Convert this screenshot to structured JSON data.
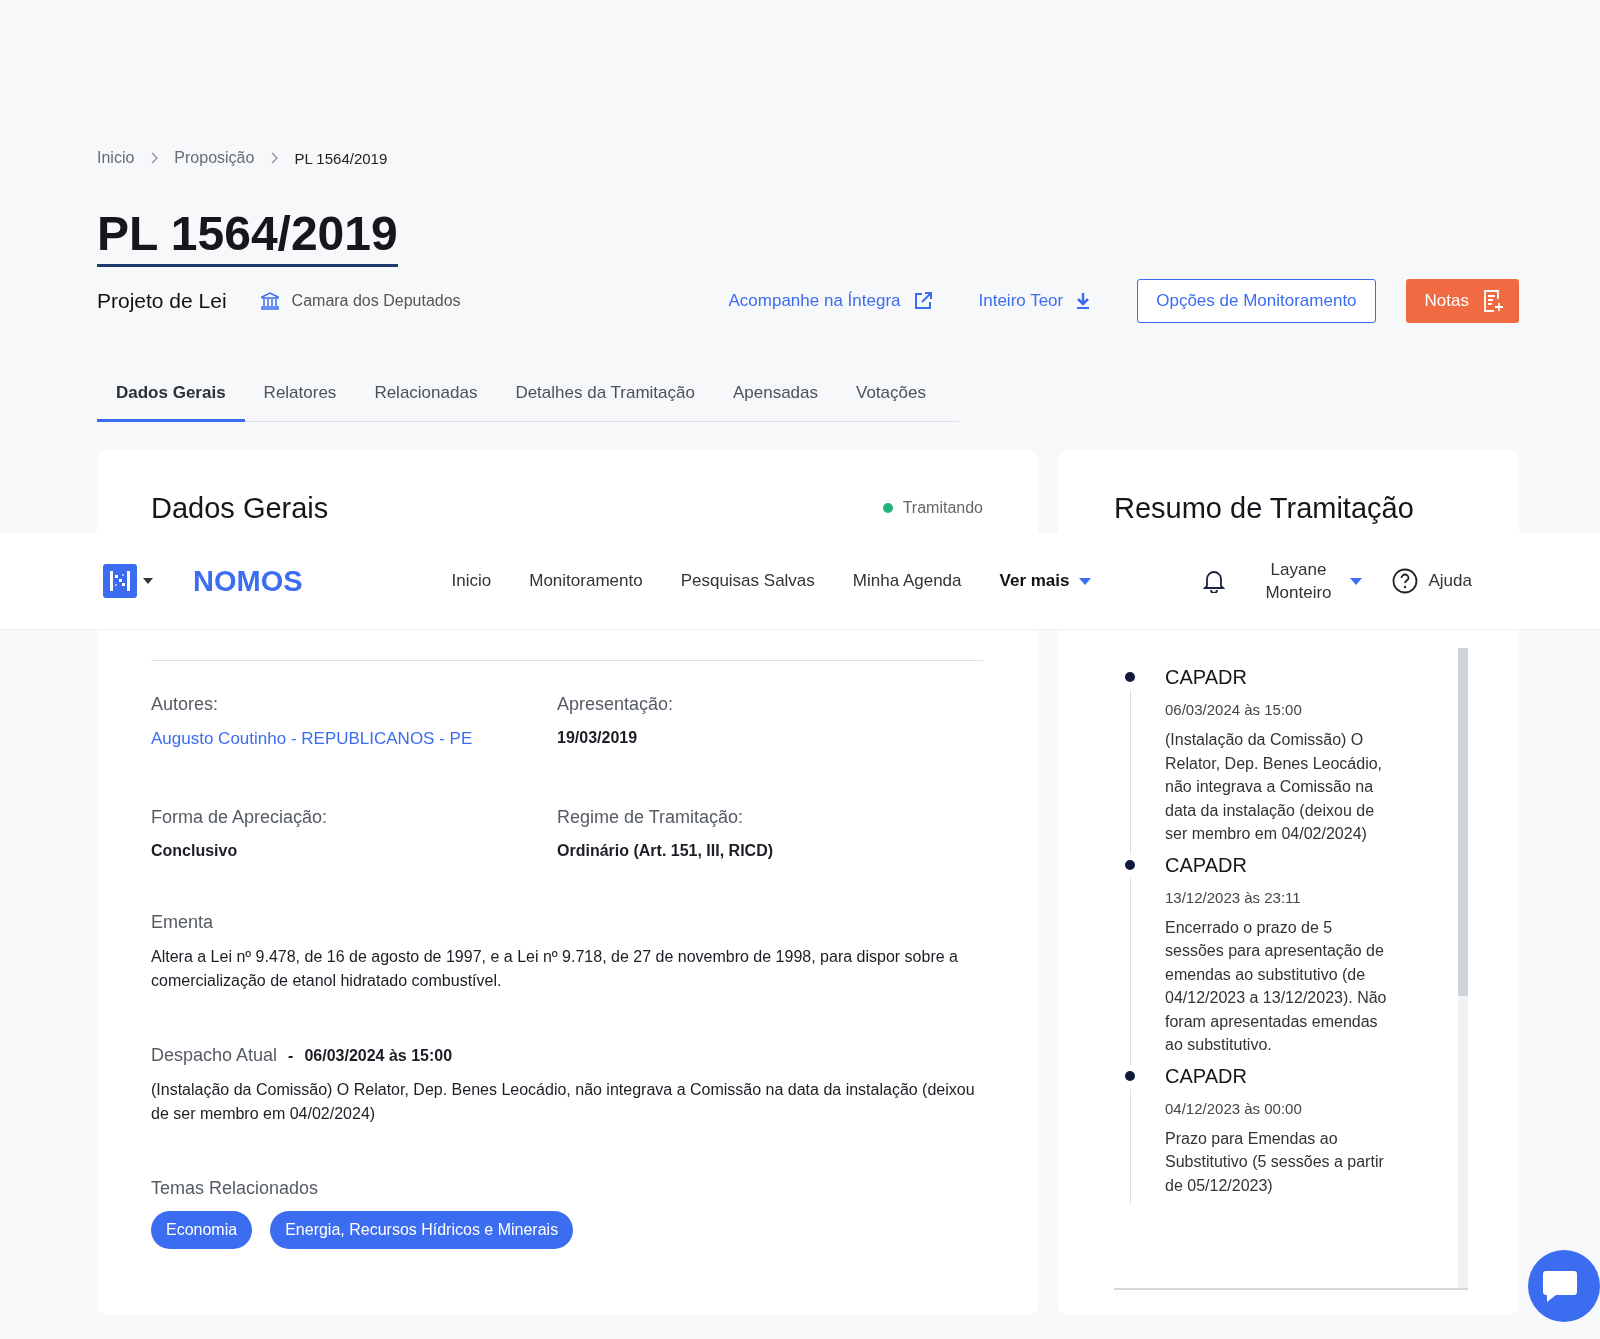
{
  "breadcrumb": [
    {
      "label": "Inicio"
    },
    {
      "label": "Proposição"
    },
    {
      "label": "PL 1564/2019"
    }
  ],
  "title": "PL 1564/2019",
  "subtitle": {
    "type": "Projeto de Lei",
    "house": "Camara dos Deputados"
  },
  "actions": [
    {
      "kind": "external",
      "label": "Acompanhe na Íntegra"
    },
    {
      "kind": "download",
      "label": "Inteiro Teor"
    },
    {
      "kind": "outline",
      "label": "Opções de Monitoramento"
    },
    {
      "kind": "notes",
      "label": "Notas"
    }
  ],
  "tabs": [
    {
      "label": "Dados Gerais",
      "selected": true
    },
    {
      "label": "Relatores",
      "selected": false
    },
    {
      "label": "Relacionadas",
      "selected": false
    },
    {
      "label": "Detalhes da Tramitação",
      "selected": false
    },
    {
      "label": "Apensadas",
      "selected": false
    },
    {
      "label": "Votações",
      "selected": false
    }
  ],
  "general": {
    "title": "Dados Gerais",
    "status": {
      "label": "Tramitando",
      "color": "#1fb57a"
    },
    "fields": [
      {
        "label": "Autores:",
        "value": "Augusto Coutinho - REPUBLICANOS - PE",
        "kind": "link"
      },
      {
        "label": "Apresentação:",
        "value": "19/03/2019",
        "kind": "text"
      },
      {
        "label": "Forma de Apreciação:",
        "value": "Conclusivo",
        "kind": "text"
      },
      {
        "label": "Regime de Tramitação:",
        "value": "Ordinário (Art. 151, III, RICD)",
        "kind": "text"
      }
    ],
    "ementa": {
      "label": "Ementa",
      "text": "Altera a Lei nº 9.478, de 16 de agosto de 1997, e a Lei nº 9.718, de 27 de novembro de 1998, para dispor sobre a comercialização de etanol hidratado combustível."
    },
    "despacho": {
      "label": "Despacho Atual",
      "separator": "-",
      "date": "06/03/2024 às 15:00",
      "text": "(Instalação da Comissão) O Relator, Dep. Benes Leocádio, não integrava a Comissão na data da instalação (deixou de ser membro em 04/02/2024)"
    },
    "temas": {
      "label": "Temas Relacionados",
      "tags": [
        "Economia",
        "Energia, Recursos Hídricos e Minerais"
      ]
    }
  },
  "summary": {
    "title": "Resumo de Tramitação",
    "items": [
      {
        "org": "CAPADR",
        "datetime": "06/03/2024 às 15:00",
        "text": "(Instalação da Comissão) O Relator, Dep. Benes Leocádio, não integrava a Comissão na data da instalação (deixou de ser membro em 04/02/2024)"
      },
      {
        "org": "CAPADR",
        "datetime": "13/12/2023 às 23:11",
        "text": "Encerrado o prazo de 5 sessões para apresentação de emendas ao substitutivo (de 04/12/2023 a 13/12/2023). Não foram apresentadas emendas ao substitutivo."
      },
      {
        "org": "CAPADR",
        "datetime": "04/12/2023 às 00:00",
        "text": "Prazo para Emendas ao Substitutivo (5 sessões a partir de 05/12/2023)"
      }
    ]
  },
  "nav": {
    "brand": "NOMOS",
    "links": [
      {
        "label": "Inicio",
        "kind": "link"
      },
      {
        "label": "Monitoramento",
        "kind": "link"
      },
      {
        "label": "Pesquisas Salvas",
        "kind": "link"
      },
      {
        "label": "Minha Agenda",
        "kind": "link"
      },
      {
        "label": "Ver mais",
        "kind": "dropdown"
      }
    ],
    "user": "Layane Monteiro",
    "help": "Ajuda"
  }
}
